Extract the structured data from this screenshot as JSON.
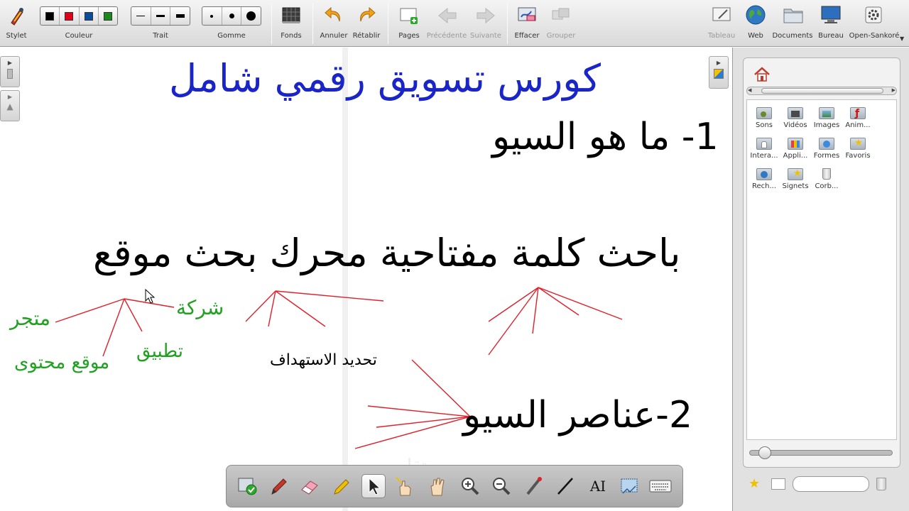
{
  "toolbar": {
    "stylet": "Stylet",
    "couleur": "Couleur",
    "trait": "Trait",
    "gomme": "Gomme",
    "fonds": "Fonds",
    "annuler": "Annuler",
    "retablir": "Rétablir",
    "pages": "Pages",
    "precedente": "Précédente",
    "suivante": "Suivante",
    "effacer": "Effacer",
    "grouper": "Grouper",
    "tableau": "Tableau",
    "web": "Web",
    "documents": "Documents",
    "bureau": "Bureau",
    "open_sankore": "Open-Sankoré",
    "colors": [
      "#000000",
      "#e0001b",
      "#0a4d9a",
      "#1a8a1a"
    ]
  },
  "board": {
    "title": "كورس تسويق رقمي شامل",
    "heading1": "1- ما هو السيو",
    "keyword_line": "باحث  كلمة مفتاحية  محرك بحث  موقع",
    "heading2": "2-عناصر السيو",
    "targeting": "تحديد الاستهداف",
    "site_types": {
      "company": "شركة",
      "store": "متجر",
      "app": "تطبيق",
      "content_site": "موقع محتوى"
    },
    "watermark": "مستقل",
    "colors": {
      "title": "#1a25c8",
      "text": "#000000",
      "green": "#22a022",
      "red_lines": "#e0202a"
    }
  },
  "library": {
    "items": [
      {
        "label": "Sons"
      },
      {
        "label": "Vidéos"
      },
      {
        "label": "Images"
      },
      {
        "label": "Anim..."
      },
      {
        "label": "Intera..."
      },
      {
        "label": "Appli..."
      },
      {
        "label": "Formes"
      },
      {
        "label": "Favoris"
      },
      {
        "label": "Rech..."
      },
      {
        "label": "Signets"
      },
      {
        "label": "Corb..."
      }
    ]
  },
  "palette": {
    "tools": [
      "presentation-icon",
      "pen-icon",
      "eraser-icon",
      "highlighter-icon",
      "pointer-icon",
      "laser-hand-icon",
      "pan-hand-icon",
      "zoom-in-icon",
      "zoom-out-icon",
      "laser-pointer-icon",
      "line-icon",
      "text-icon",
      "capture-icon",
      "keyboard-icon"
    ],
    "text_tool_label": "AI"
  }
}
